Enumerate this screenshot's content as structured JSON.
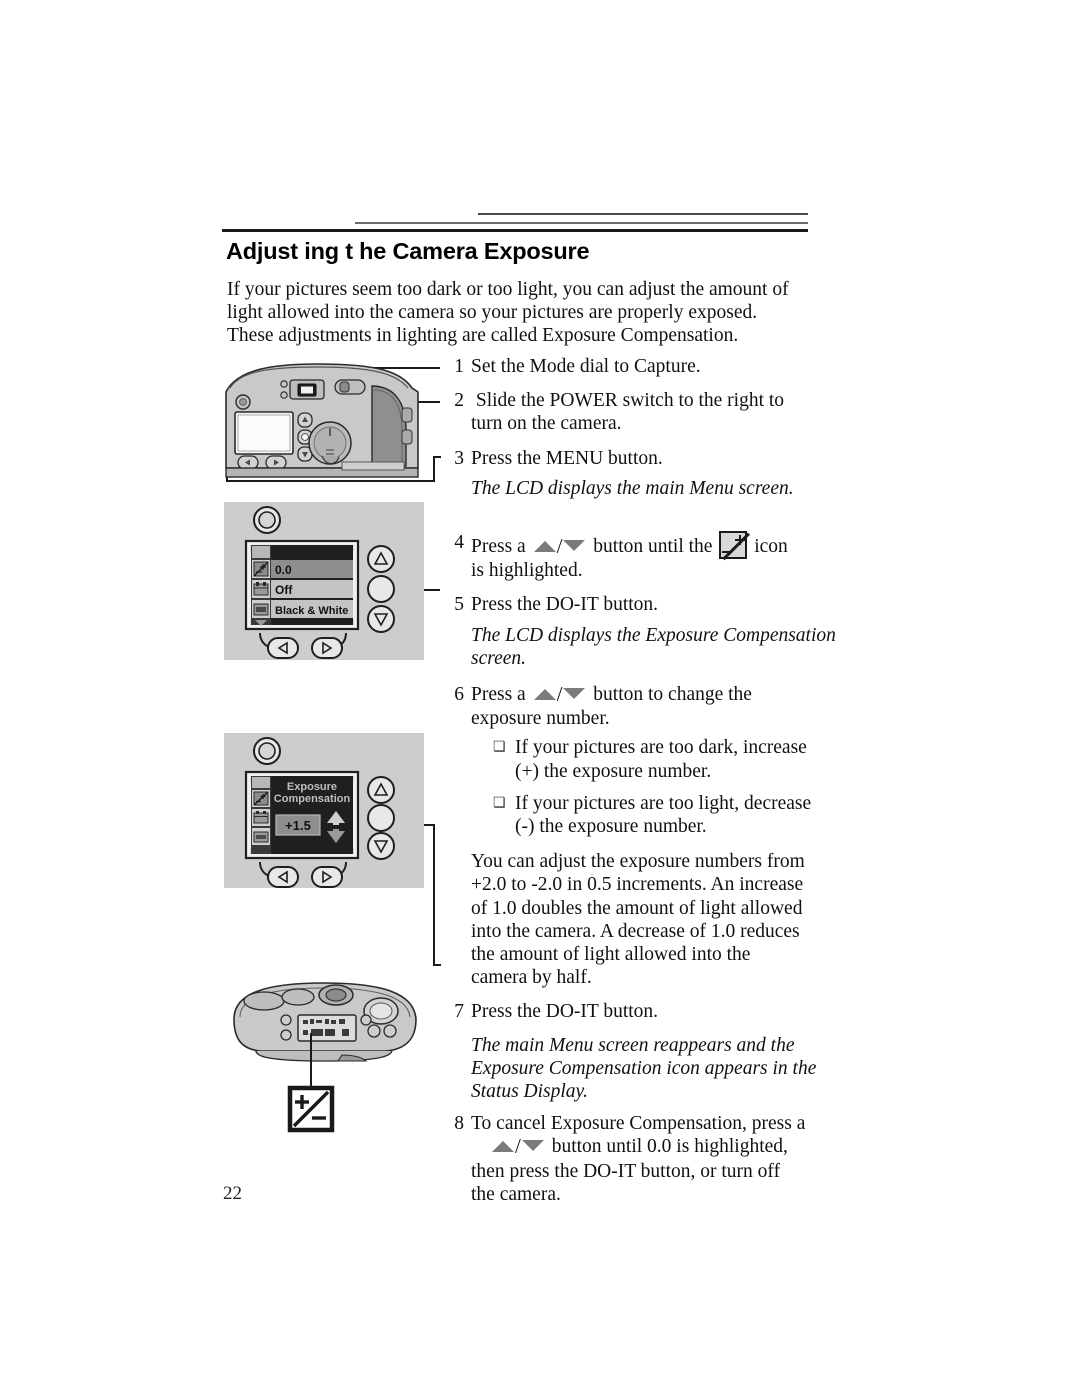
{
  "page": {
    "number": "22",
    "heading": "Adjust ing t he Camera Exposure"
  },
  "intro": {
    "line1": "If your pictures seem too dark or too light, you can adjust the amount of",
    "line2": "light allowed into the camera so your pictures are properly exposed.",
    "line3": "These adjustments in lighting are called Exposure Compensation."
  },
  "steps": [
    {
      "num": "1",
      "lines": [
        "Set the Mode dial to Capture."
      ]
    },
    {
      "num": "2",
      "lines": [
        " Slide the POWER switch to the right to",
        "turn on the camera."
      ]
    },
    {
      "num": "3",
      "lines": [
        "Press the MENU button."
      ],
      "note": [
        "The LCD displays the main Menu screen."
      ]
    },
    {
      "num": "4",
      "pre": "Press a ",
      "mid": " button until the ",
      "post": " icon",
      "lines": [
        "is highlighted."
      ]
    },
    {
      "num": "5",
      "lines": [
        "Press the DO-IT button."
      ],
      "note": [
        "The LCD displays the Exposure Compensation",
        "screen."
      ]
    },
    {
      "num": "6",
      "pre": "Press a ",
      "mid": " button to change the",
      "lines": [
        "exposure number."
      ],
      "bullets": [
        [
          "If your pictures are too dark, increase",
          "(+) the exposure number."
        ],
        [
          "If your pictures are too light, decrease",
          "(-) the exposure number."
        ]
      ],
      "paragraph": [
        "You can adjust the exposure numbers from",
        "+2.0 to -2.0 in 0.5 increments. An increase",
        "of 1.0 doubles the amount of light allowed",
        "into the camera. A decrease of 1.0 reduces",
        "the amount of light allowed into the",
        "camera by half."
      ]
    },
    {
      "num": "7",
      "lines": [
        "Press the DO-IT button."
      ],
      "note": [
        "The main Menu screen reappears and the",
        "Exposure Compensation icon appears in the",
        "Status Display."
      ]
    },
    {
      "num": "8",
      "pre": "To cancel Exposure Compensation, press a",
      "mid": " button until 0.0 is highlighted,",
      "lines": [
        "then press the DO-IT button, or turn off",
        "the camera."
      ]
    }
  ],
  "bullet_mark": "❑",
  "slash": "/",
  "illustrations": {
    "camera_back": {
      "label": "camera-back-view",
      "parts": [
        "shutter-button",
        "viewfinder",
        "power-switch",
        "lcd-screen",
        "mode-dial",
        "up-button",
        "doit-button",
        "down-button",
        "left-button",
        "right-button"
      ]
    },
    "menu_screen": {
      "label": "lcd-main-menu",
      "rows": [
        {
          "icon": "exposure-compensation-icon",
          "value": "0.0",
          "highlighted": true
        },
        {
          "icon": "date-stamp-icon",
          "value": "Off",
          "highlighted": false
        },
        {
          "icon": "picture-effect-icon",
          "value": "Black & White",
          "highlighted": false
        }
      ]
    },
    "exposure_screen": {
      "label": "lcd-exposure-compensation",
      "title_line1": "Exposure",
      "title_line2": "Compensation",
      "value": "+1.5",
      "up_arrow": "▲",
      "down_arrow": "▼"
    },
    "camera_top": {
      "label": "camera-top-view",
      "callout_icon": "exposure-compensation-plus-minus-icon"
    }
  },
  "colors": {
    "text": "#111111",
    "rule_dark": "#1a1a1a",
    "rule_mid": "#6a6a6a",
    "panel_bg": "#cdcdcd",
    "lcd_dark": "#2b2b2b",
    "lcd_row": "#b9b9b9",
    "triangle_gray": "#7b7b7b",
    "camera_body": "#c9c9c9"
  }
}
